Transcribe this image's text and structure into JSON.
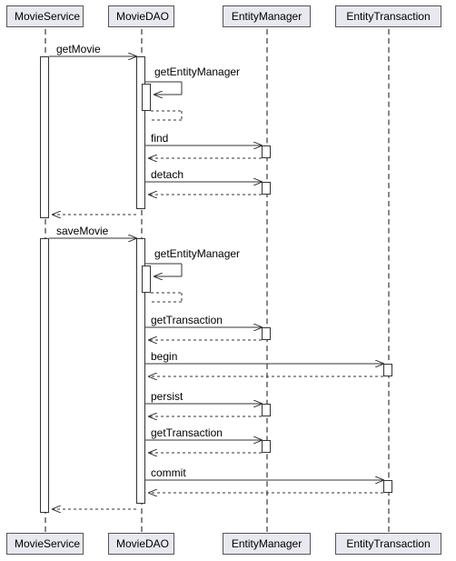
{
  "participants": {
    "p0": "MovieService",
    "p1": "MovieDAO",
    "p2": "EntityManager",
    "p3": "EntityTransaction"
  },
  "messages": {
    "m0": "getMovie",
    "m1": "getEntityManager",
    "m2": "find",
    "m3": "detach",
    "m4": "saveMovie",
    "m5": "getEntityManager",
    "m6": "getTransaction",
    "m7": "begin",
    "m8": "persist",
    "m9": "getTransaction",
    "m10": "commit"
  },
  "chart_data": {
    "type": "sequence",
    "participants": [
      "MovieService",
      "MovieDAO",
      "EntityManager",
      "EntityTransaction"
    ],
    "interactions": [
      {
        "from": "MovieService",
        "to": "MovieDAO",
        "label": "getMovie",
        "kind": "call"
      },
      {
        "from": "MovieDAO",
        "to": "MovieDAO",
        "label": "getEntityManager",
        "kind": "self"
      },
      {
        "from": "MovieDAO",
        "to": "EntityManager",
        "label": "find",
        "kind": "call"
      },
      {
        "from": "EntityManager",
        "to": "MovieDAO",
        "label": "",
        "kind": "return"
      },
      {
        "from": "MovieDAO",
        "to": "EntityManager",
        "label": "detach",
        "kind": "call"
      },
      {
        "from": "EntityManager",
        "to": "MovieDAO",
        "label": "",
        "kind": "return"
      },
      {
        "from": "MovieDAO",
        "to": "MovieService",
        "label": "",
        "kind": "return"
      },
      {
        "from": "MovieService",
        "to": "MovieDAO",
        "label": "saveMovie",
        "kind": "call"
      },
      {
        "from": "MovieDAO",
        "to": "MovieDAO",
        "label": "getEntityManager",
        "kind": "self"
      },
      {
        "from": "MovieDAO",
        "to": "EntityManager",
        "label": "getTransaction",
        "kind": "call"
      },
      {
        "from": "EntityManager",
        "to": "MovieDAO",
        "label": "",
        "kind": "return"
      },
      {
        "from": "MovieDAO",
        "to": "EntityTransaction",
        "label": "begin",
        "kind": "call"
      },
      {
        "from": "EntityTransaction",
        "to": "MovieDAO",
        "label": "",
        "kind": "return"
      },
      {
        "from": "MovieDAO",
        "to": "EntityManager",
        "label": "persist",
        "kind": "call"
      },
      {
        "from": "EntityManager",
        "to": "MovieDAO",
        "label": "",
        "kind": "return"
      },
      {
        "from": "MovieDAO",
        "to": "EntityManager",
        "label": "getTransaction",
        "kind": "call"
      },
      {
        "from": "EntityManager",
        "to": "MovieDAO",
        "label": "",
        "kind": "return"
      },
      {
        "from": "MovieDAO",
        "to": "EntityTransaction",
        "label": "commit",
        "kind": "call"
      },
      {
        "from": "EntityTransaction",
        "to": "MovieDAO",
        "label": "",
        "kind": "return"
      },
      {
        "from": "MovieDAO",
        "to": "MovieService",
        "label": "",
        "kind": "return"
      }
    ]
  }
}
